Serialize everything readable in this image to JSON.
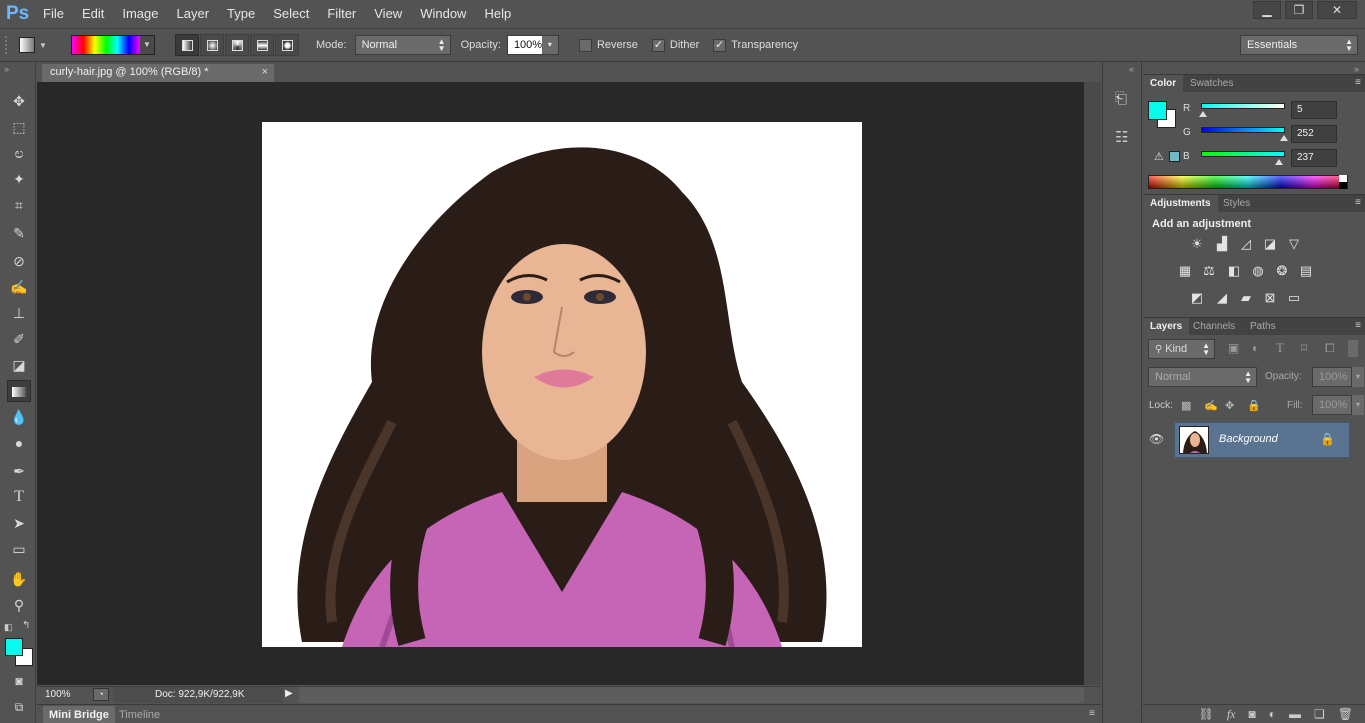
{
  "app": {
    "logo": "Ps"
  },
  "menu": [
    "File",
    "Edit",
    "Image",
    "Layer",
    "Type",
    "Select",
    "Filter",
    "View",
    "Window",
    "Help"
  ],
  "window_buttons": {
    "minimize": "▁",
    "restore": "❐",
    "close": "✕"
  },
  "options": {
    "mode_label": "Mode:",
    "mode_value": "Normal",
    "opacity_label": "Opacity:",
    "opacity_value": "100%",
    "reverse_label": "Reverse",
    "reverse_checked": false,
    "dither_label": "Dither",
    "dither_checked": true,
    "transparency_label": "Transparency",
    "transparency_checked": true,
    "workspace": "Essentials"
  },
  "document": {
    "tab_title": "curly-hair.jpg @ 100% (RGB/8) *",
    "zoom": "100%",
    "doc_size": "Doc: 922,9K/922,9K"
  },
  "bottom_tabs": [
    "Mini Bridge",
    "Timeline"
  ],
  "color_panel": {
    "tabs": [
      "Color",
      "Swatches"
    ],
    "foreground": "#05fced",
    "background": "#ffffff",
    "sliders": [
      {
        "name": "R",
        "value": "5",
        "fraction": 0.02
      },
      {
        "name": "G",
        "value": "252",
        "fraction": 0.99
      },
      {
        "name": "B",
        "value": "237",
        "fraction": 0.93
      }
    ]
  },
  "adjustments_panel": {
    "tabs": [
      "Adjustments",
      "Styles"
    ],
    "heading": "Add an adjustment",
    "icons": [
      [
        "brightness-contrast-icon",
        "levels-icon",
        "curves-icon",
        "exposure-icon",
        "vibrance-icon"
      ],
      [
        "hue-saturation-icon",
        "color-balance-icon",
        "black-white-icon",
        "photo-filter-icon",
        "channel-mixer-icon",
        "color-lookup-icon"
      ],
      [
        "invert-icon",
        "posterize-icon",
        "threshold-icon",
        "selective-color-icon",
        "gradient-map-icon"
      ]
    ]
  },
  "layers_panel": {
    "tabs": [
      "Layers",
      "Channels",
      "Paths"
    ],
    "filter_kind": "Kind",
    "blend_mode": "Normal",
    "opacity_label": "Opacity:",
    "opacity_value": "100%",
    "lock_label": "Lock:",
    "fill_label": "Fill:",
    "fill_value": "100%",
    "layers": [
      {
        "name": "Background",
        "locked": true,
        "visible": true
      }
    ],
    "footer_icons": [
      "link-layers-icon",
      "fx-icon",
      "add-mask-icon",
      "adjustment-layer-icon",
      "group-icon",
      "new-layer-icon",
      "trash-icon"
    ]
  },
  "tools": [
    "move",
    "marquee",
    "lasso",
    "magic-wand",
    "crop",
    "eyedropper",
    "spot-healing",
    "brush",
    "clone-stamp",
    "history-brush",
    "eraser",
    "gradient",
    "blur",
    "dodge",
    "pen",
    "type",
    "path-selection",
    "rectangle",
    "hand",
    "zoom"
  ],
  "fg_color": "#05fced",
  "bg_color": "#ffffff"
}
